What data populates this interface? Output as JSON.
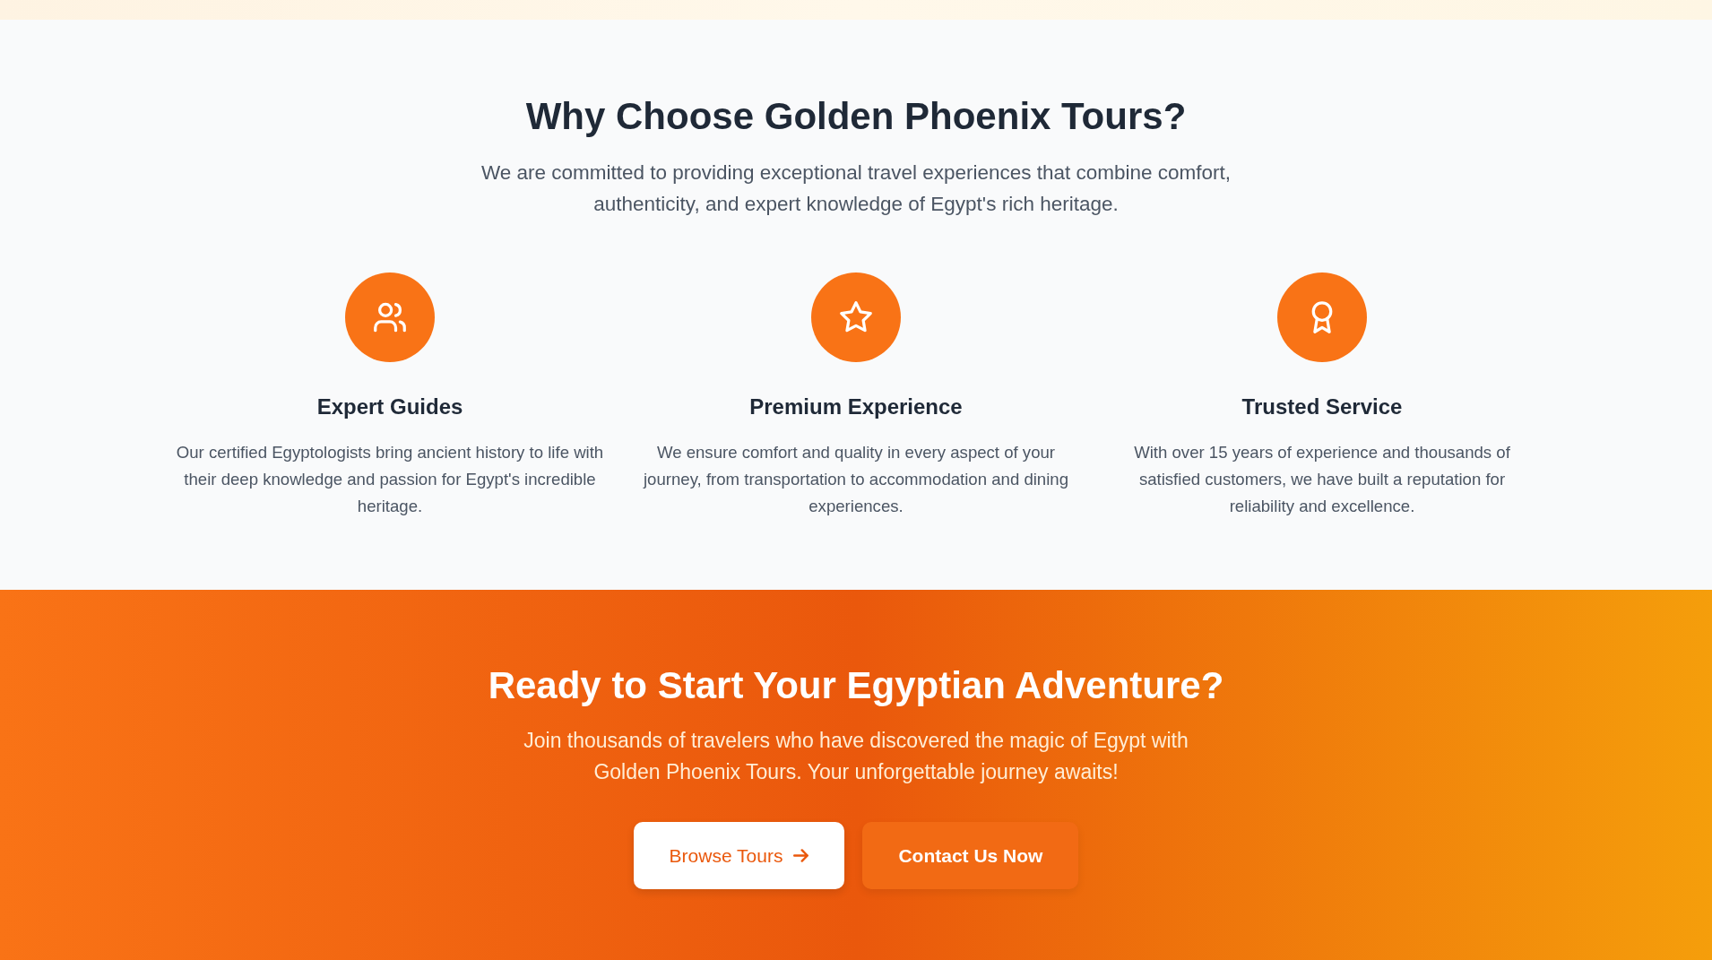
{
  "why_section": {
    "title": "Why Choose Golden Phoenix Tours?",
    "subtitle": "We are committed to providing exceptional travel experiences that combine comfort, authenticity, and expert knowledge of Egypt's rich heritage.",
    "features": [
      {
        "title": "Expert Guides",
        "description": "Our certified Egyptologists bring ancient history to life with their deep knowledge and passion for Egypt's incredible heritage."
      },
      {
        "title": "Premium Experience",
        "description": "We ensure comfort and quality in every aspect of your journey, from transportation to accommodation and dining experiences."
      },
      {
        "title": "Trusted Service",
        "description": "With over 15 years of experience and thousands of satisfied customers, we have built a reputation for reliability and excellence."
      }
    ]
  },
  "cta_section": {
    "title": "Ready to Start Your Egyptian Adventure?",
    "subtitle": "Join thousands of travelers who have discovered the magic of Egypt with Golden Phoenix Tours. Your unforgettable journey awaits!",
    "buttons": [
      {
        "label": "Browse Tours",
        "kind": "primary"
      },
      {
        "label": "Contact Us Now",
        "kind": "secondary"
      }
    ]
  }
}
